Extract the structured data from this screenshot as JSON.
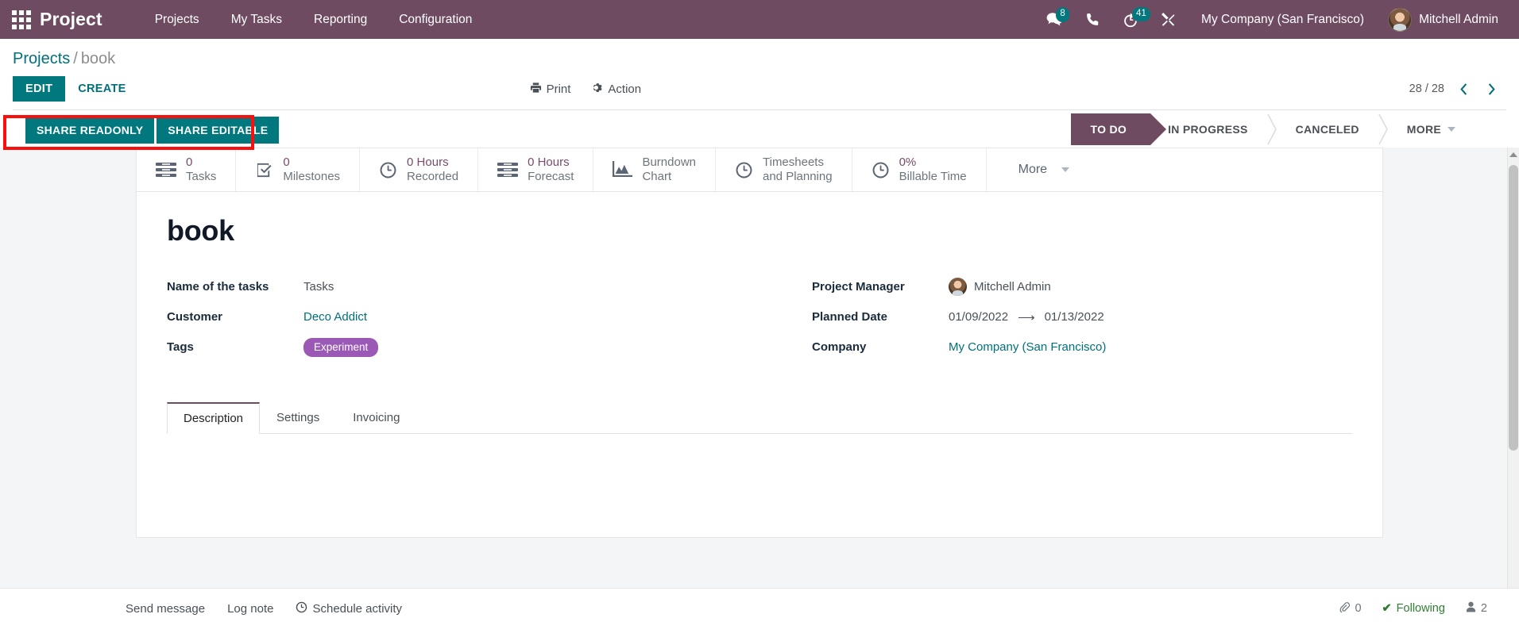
{
  "navbar": {
    "apps_icon": "apps-grid-icon",
    "brand": "Project",
    "menu": [
      {
        "label": "Projects"
      },
      {
        "label": "My Tasks"
      },
      {
        "label": "Reporting"
      },
      {
        "label": "Configuration"
      }
    ],
    "messages_icon": "messages-icon",
    "messages_count": "8",
    "phone_icon": "phone-icon",
    "activity_icon": "clock-activity-icon",
    "activity_count": "41",
    "tools_icon": "crossed-tools-icon",
    "company": "My Company (San Francisco)",
    "user": "Mitchell Admin"
  },
  "breadcrumb": {
    "root": "Projects",
    "separator": "/",
    "current": "book"
  },
  "control_panel": {
    "edit_label": "EDIT",
    "create_label": "CREATE",
    "print_label": "Print",
    "print_icon": "printer-icon",
    "action_label": "Action",
    "action_icon": "gear-icon",
    "pager": "28 / 28",
    "prev_icon": "chevron-left-icon",
    "next_icon": "chevron-right-icon"
  },
  "share": {
    "readonly_label": "SHARE READONLY",
    "editable_label": "SHARE EDITABLE"
  },
  "statusbar": {
    "stages": [
      {
        "label": "TO DO",
        "active": true
      },
      {
        "label": "IN PROGRESS",
        "active": false
      },
      {
        "label": "CANCELED",
        "active": false
      },
      {
        "label": "MORE",
        "active": false,
        "has_caret": true
      }
    ]
  },
  "stat_buttons": [
    {
      "icon": "list-lines-icon",
      "value": "0",
      "label": "Tasks"
    },
    {
      "icon": "check-square-icon",
      "value": "0",
      "label": "Milestones"
    },
    {
      "icon": "clock-icon",
      "value": "0 Hours",
      "label": "Recorded"
    },
    {
      "icon": "list-lines-icon",
      "value": "0 Hours",
      "label": "Forecast"
    },
    {
      "icon": "area-chart-icon",
      "value": "Burndown",
      "label": "Chart"
    },
    {
      "icon": "clock-icon",
      "value": "Timesheets",
      "label": "and Planning"
    },
    {
      "icon": "clock-icon",
      "value": "0%",
      "label": "Billable Time"
    }
  ],
  "stat_more": {
    "label": "More",
    "caret_icon": "caret-down-icon"
  },
  "record": {
    "title": "book",
    "left_fields": [
      {
        "label": "Name of the tasks",
        "value": "Tasks",
        "type": "text"
      },
      {
        "label": "Customer",
        "value": "Deco Addict",
        "type": "link"
      },
      {
        "label": "Tags",
        "value": "Experiment",
        "type": "tag"
      }
    ],
    "right_fields": {
      "project_manager_label": "Project Manager",
      "project_manager_value": "Mitchell Admin",
      "planned_date_label": "Planned Date",
      "planned_date_start": "01/09/2022",
      "planned_date_arrow": "⟶",
      "planned_date_end": "01/13/2022",
      "company_label": "Company",
      "company_value": "My Company (San Francisco)"
    }
  },
  "notebook": {
    "tabs": [
      {
        "label": "Description",
        "active": true
      },
      {
        "label": "Settings",
        "active": false
      },
      {
        "label": "Invoicing",
        "active": false
      }
    ]
  },
  "chatter": {
    "send_message": "Send message",
    "log_note": "Log note",
    "schedule_activity": "Schedule activity",
    "schedule_icon": "clock-plus-icon",
    "attachment_icon": "paperclip-icon",
    "attachment_count": "0",
    "following_label": "Following",
    "following_icon": "check-icon",
    "followers_icon": "user-icon",
    "followers_count": "2"
  },
  "colors": {
    "brand_purple": "#6f4b62",
    "teal": "#00787d",
    "link_teal": "#00707a",
    "tag_purple": "#9b59b6",
    "annotation_red": "#fa0f0f",
    "stat_value": "#7a4b6b"
  }
}
